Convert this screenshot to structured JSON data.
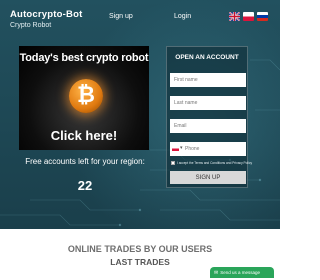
{
  "header": {
    "brand_name": "Autocrypto-Bot",
    "brand_subtitle": "Crypto Robot",
    "signup_link": "Sign up",
    "login_link": "Login",
    "languages": [
      "English",
      "Polish",
      "Russian"
    ]
  },
  "banner": {
    "title": "Today's best crypto robot",
    "coin_symbol": "₿",
    "cta": "Click here!"
  },
  "promo": {
    "free_accounts_text": "Free accounts left for your region:",
    "count": "22"
  },
  "form": {
    "title": "OPEN AN ACCOUNT",
    "first_name_placeholder": "First name",
    "last_name_placeholder": "Last name",
    "email_placeholder": "Email",
    "phone_placeholder": "Phone",
    "phone_caret": "▾",
    "consent_label": "I accept the Terms and Conditions and Privacy Policy",
    "submit_label": "SIGN UP"
  },
  "trades": {
    "title": "ONLINE TRADES BY OUR USERS",
    "subtitle": "LAST TRADES"
  },
  "chat": {
    "icon": "chat-bubble-icon",
    "label": "Send us a message"
  },
  "colors": {
    "hero_bg": "#1d4653",
    "chat_green": "#2aa55a",
    "signup_button": "#d8d8d8"
  }
}
